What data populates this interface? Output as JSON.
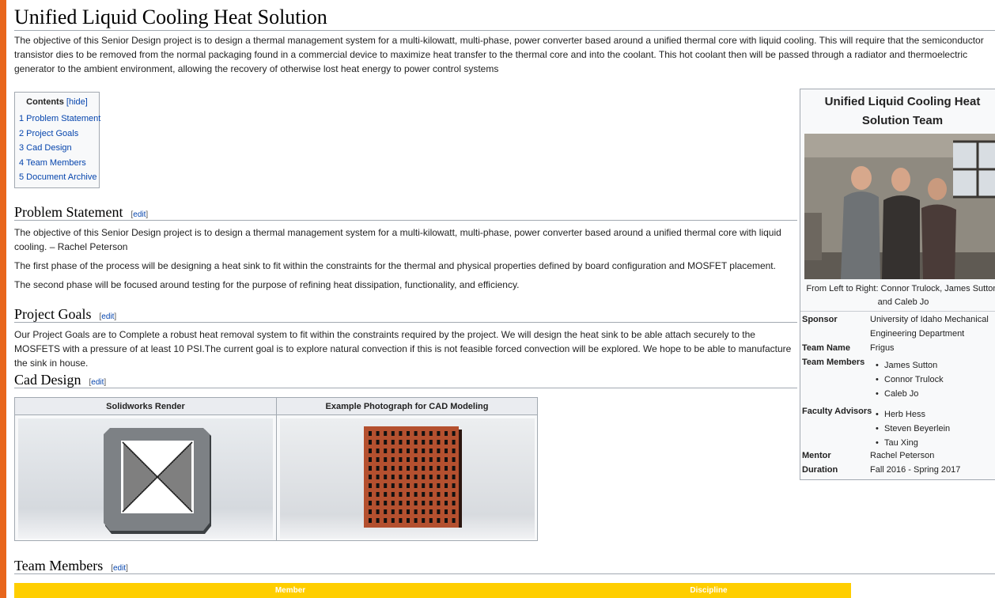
{
  "page": {
    "title": "Unified Liquid Cooling Heat Solution",
    "intro": "The objective of this Senior Design project is to design a thermal management system for a multi-kilowatt, multi-phase, power converter based around a unified thermal core with liquid cooling. This will require that the semiconductor transistor dies to be removed from the normal packaging found in a commercial device to maximize heat transfer to the thermal core and into the coolant. This hot coolant then will be passed through a radiator and thermoelectric generator to the ambient environment, allowing the recovery of otherwise lost heat energy to power control systems"
  },
  "toc": {
    "heading": "Contents",
    "toggle": "[hide]",
    "items": [
      "1 Problem Statement",
      "2 Project Goals",
      "3 Cad Design",
      "4 Team Members",
      "5 Document Archive"
    ]
  },
  "edit_label": "edit",
  "sections": {
    "problem": {
      "heading": "Problem Statement",
      "p1": "The objective of this Senior Design project is to design a thermal management system for a multi-kilowatt, multi-phase, power converter based around a unified thermal core with liquid cooling. – Rachel Peterson",
      "p2": "The first phase of the process will be designing a heat sink to fit within the constraints for the thermal and physical properties defined by board configuration and MOSFET placement.",
      "p3": "The second phase will be focused around testing for the purpose of refining heat dissipation, functionality, and efficiency."
    },
    "goals": {
      "heading": "Project Goals",
      "p1": "Our Project Goals are to Complete a robust heat removal system to fit within the constraints required by the project. We will design the heat sink to be able attach securely to the MOSFETS with a pressure of at least 10 PSI.The current goal is to explore natural convection if this is not feasible forced convection will be explored. We hope to be able to manufacture the sink in house."
    },
    "cad": {
      "heading": "Cad Design",
      "col1": "Solidworks Render",
      "col2": "Example Photograph for CAD Modeling"
    },
    "team": {
      "heading": "Team Members",
      "col1": "Member",
      "col2": "Discipline"
    }
  },
  "infobox": {
    "title": "Unified Liquid Cooling Heat Solution Team",
    "caption": "From Left to Right: Connor Trulock, James Sutton, and Caleb Jo",
    "sponsor_label": "Sponsor",
    "sponsor": "University of Idaho Mechanical Engineering Department",
    "team_name_label": "Team Name",
    "team_name": "Frigus",
    "members_label": "Team Members",
    "members": [
      "James Sutton",
      "Connor Trulock",
      "Caleb Jo"
    ],
    "advisors_label": "Faculty Advisors",
    "advisors": [
      "Herb Hess",
      "Steven Beyerlein",
      "Tau Xing"
    ],
    "mentor_label": "Mentor",
    "mentor": "Rachel Peterson",
    "duration_label": "Duration",
    "duration": "Fall 2016 - Spring 2017"
  },
  "colors": {
    "border_orange": "#e8661c",
    "link": "#0645ad",
    "table_header": "#ffce00",
    "heatsink_copper": "#b4502f"
  }
}
